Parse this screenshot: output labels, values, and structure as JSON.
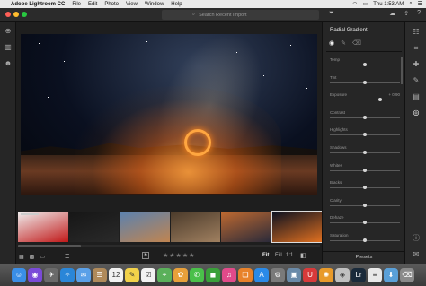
{
  "menubar": {
    "apple": "",
    "app_name": "Adobe Lightroom CC",
    "items": [
      "File",
      "Edit",
      "Photo",
      "View",
      "Window",
      "Help"
    ],
    "clock": "Thu 1:53 AM"
  },
  "titlebar": {
    "search_placeholder": "Search Recent Import"
  },
  "edit_panel": {
    "title": "Radial Gradient",
    "sliders": [
      {
        "label": "Temp",
        "value": "",
        "position": 0.5
      },
      {
        "label": "Tint",
        "value": "",
        "position": 0.5
      },
      {
        "label": "Exposure",
        "value": "+ 0.90",
        "position": 0.72
      },
      {
        "label": "Contrast",
        "value": "",
        "position": 0.5
      },
      {
        "label": "Highlights",
        "value": "",
        "position": 0.5
      },
      {
        "label": "Shadows",
        "value": "",
        "position": 0.5
      },
      {
        "label": "Whites",
        "value": "",
        "position": 0.5
      },
      {
        "label": "Blacks",
        "value": "",
        "position": 0.5
      },
      {
        "label": "Clarity",
        "value": "",
        "position": 0.5
      },
      {
        "label": "Dehaze",
        "value": "",
        "position": 0.5
      },
      {
        "label": "Saturation",
        "value": "",
        "position": 0.5
      }
    ],
    "presets_label": "Presets"
  },
  "bottombar": {
    "stars": "★★★★★",
    "fit_label": "Fit",
    "fill_label": "Fill",
    "one_label": "1:1"
  },
  "filmstrip": {
    "thumbs": [
      {
        "name": "red-car",
        "colors": [
          "#f0f0f0",
          "#c01818"
        ]
      },
      {
        "name": "dark-sketch",
        "colors": [
          "#161616",
          "#2a2a2a"
        ]
      },
      {
        "name": "coast-sunset",
        "colors": [
          "#5a82b0",
          "#c08450"
        ]
      },
      {
        "name": "coffee-cups",
        "colors": [
          "#4a3a2a",
          "#a08060"
        ]
      },
      {
        "name": "mountain-dusk",
        "colors": [
          "#c06a30",
          "#2a2a3a"
        ]
      },
      {
        "name": "steel-wool",
        "colors": [
          "#0a1020",
          "#e07020"
        ]
      }
    ],
    "selected_index": 5
  },
  "dock": {
    "apps": [
      {
        "name": "finder",
        "glyph": "☺",
        "color": "#3a8ee6"
      },
      {
        "name": "siri",
        "glyph": "◉",
        "color": "#7a4ad8"
      },
      {
        "name": "launchpad",
        "glyph": "✈",
        "color": "#6a6a6a"
      },
      {
        "name": "safari",
        "glyph": "✧",
        "color": "#2a86d8"
      },
      {
        "name": "mail",
        "glyph": "✉",
        "color": "#5aa0e8"
      },
      {
        "name": "contacts",
        "glyph": "☰",
        "color": "#b08a5a"
      },
      {
        "name": "calendar",
        "glyph": "12",
        "color": "#f2f2f2"
      },
      {
        "name": "notes",
        "glyph": "✎",
        "color": "#f2d24a"
      },
      {
        "name": "reminders",
        "glyph": "☑",
        "color": "#f2f2f2"
      },
      {
        "name": "maps",
        "glyph": "⌖",
        "color": "#5ab05a"
      },
      {
        "name": "photos",
        "glyph": "✿",
        "color": "#e8a03a"
      },
      {
        "name": "messages",
        "glyph": "✆",
        "color": "#4ac04a"
      },
      {
        "name": "facetime",
        "glyph": "◼",
        "color": "#3aa03a"
      },
      {
        "name": "itunes",
        "glyph": "♫",
        "color": "#e24a8a"
      },
      {
        "name": "ibooks",
        "glyph": "❑",
        "color": "#e8822a"
      },
      {
        "name": "app-store",
        "glyph": "A",
        "color": "#2a8ae8"
      },
      {
        "name": "system-preferences",
        "glyph": "⚙",
        "color": "#7a7a7a"
      },
      {
        "name": "preview",
        "glyph": "▣",
        "color": "#6a8aa8"
      },
      {
        "name": "magnet",
        "glyph": "U",
        "color": "#d83a3a"
      },
      {
        "name": "burst",
        "glyph": "✺",
        "color": "#e89a2a"
      },
      {
        "name": "photo-app",
        "glyph": "◈",
        "color": "#c0c0c0"
      },
      {
        "name": "lightroom",
        "glyph": "Lr",
        "color": "#1a2a3a"
      },
      {
        "name": "notes-2",
        "glyph": "≡",
        "color": "#e8e8e8"
      },
      {
        "name": "downloads-folder",
        "glyph": "⬇",
        "color": "#5aa0d8"
      },
      {
        "name": "trash",
        "glyph": "⌫",
        "color": "#8a8a8a"
      }
    ]
  }
}
